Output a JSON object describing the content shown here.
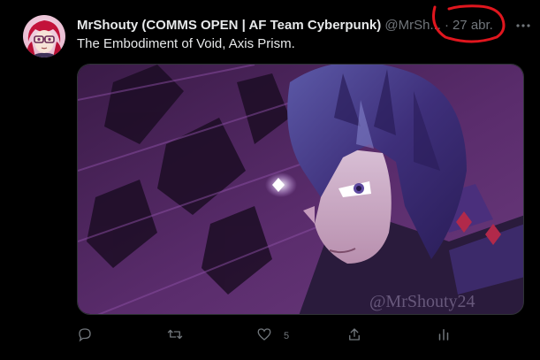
{
  "tweet": {
    "display_name": "MrShouty (COMMS OPEN | AF Team Cyberpunk)",
    "handle": "@MrSh...",
    "separator": "·",
    "date": "27 abr.",
    "text": "The Embodiment of Void, Axis Prism.",
    "watermark": "@MrShouty24"
  },
  "actions": {
    "reply_count": "",
    "retweet_count": "",
    "like_count": "5",
    "share_count": ""
  },
  "colors": {
    "background": "#000000",
    "text_primary": "#e7e9ea",
    "text_secondary": "#71767b",
    "annotation_red": "#e0161e"
  },
  "icons": [
    "avatar",
    "more-icon",
    "reply-icon",
    "retweet-icon",
    "like-icon",
    "share-icon",
    "analytics-icon"
  ]
}
